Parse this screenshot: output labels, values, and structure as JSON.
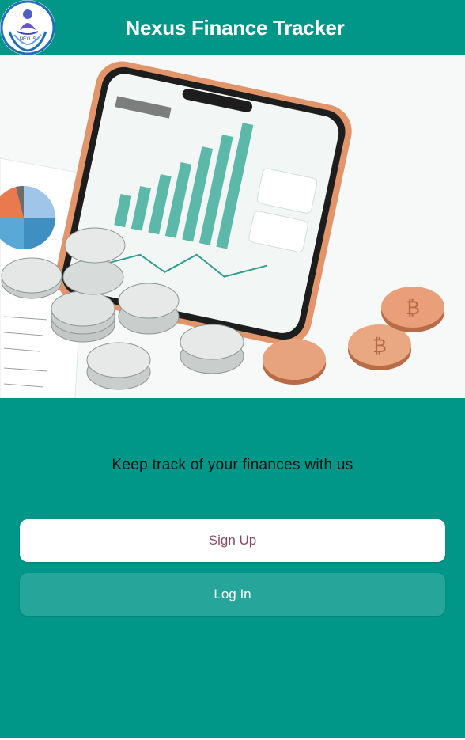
{
  "app": {
    "title": "Nexus Finance Tracker",
    "logo_text": "NEXUS"
  },
  "hero": {
    "image_label": "phone-with-finance-chart-and-coins"
  },
  "main": {
    "tagline": "Keep track of your finances with us",
    "signup_label": "Sign Up",
    "login_label": "Log In"
  },
  "colors": {
    "primary": "#009688",
    "button_secondary": "#26a69a",
    "signup_text": "#8a4a63"
  }
}
